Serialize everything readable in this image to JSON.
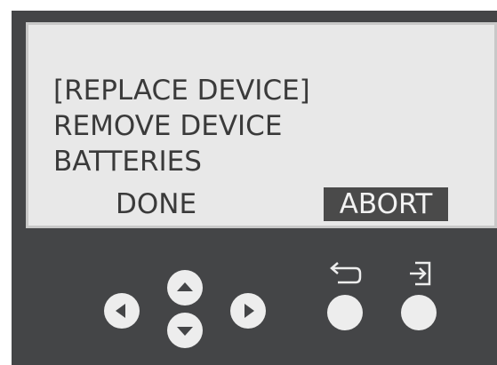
{
  "display": {
    "lines": [
      "[REPLACE DEVICE]",
      "REMOVE DEVICE",
      "BATTERIES"
    ],
    "softkeys": {
      "left": "DONE",
      "right": "ABORT"
    }
  },
  "keypad": {
    "navigation": [
      "left-arrow-icon",
      "up-arrow-icon",
      "down-arrow-icon",
      "right-arrow-icon"
    ],
    "action_icons": [
      "back-arrow-icon",
      "enter-icon"
    ]
  },
  "colors": {
    "housing": "#444547",
    "screen_bg": "#e8e8e8",
    "screen_text": "#3a3a3a",
    "highlight_bg": "#4a4a4a",
    "button": "#ededed"
  }
}
